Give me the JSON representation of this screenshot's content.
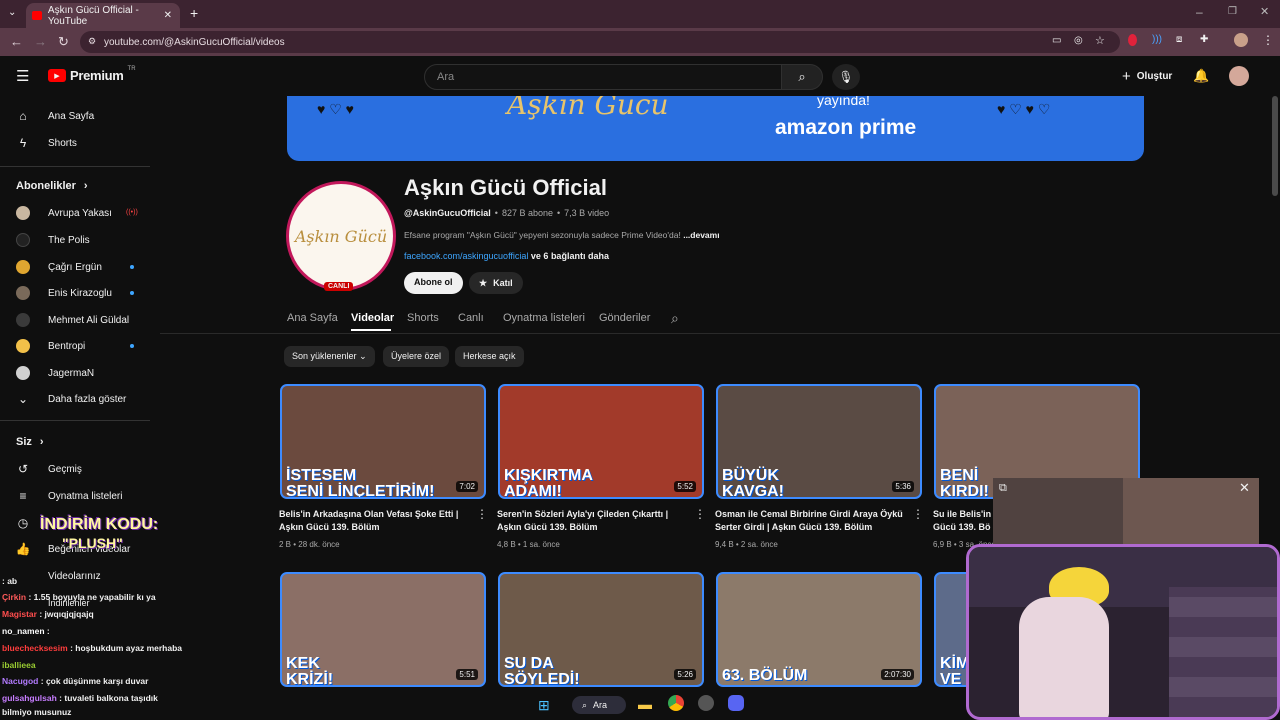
{
  "browser": {
    "tab_title": "Aşkın Gücü Official - YouTube",
    "url": "youtube.com/@AskinGucuOfficial/videos"
  },
  "header": {
    "logo": "Premium",
    "logo_region": "TR",
    "search_placeholder": "Ara",
    "create_label": "Oluştur"
  },
  "sidebar": {
    "main": [
      {
        "label": "Ana Sayfa",
        "icon": "home-icon"
      },
      {
        "label": "Shorts",
        "icon": "shorts-icon"
      }
    ],
    "subs_heading": "Abonelikler",
    "subs": [
      {
        "label": "Avrupa Yakası",
        "color": "#c9b7a0",
        "badge": "live"
      },
      {
        "label": "The Polis",
        "color": "#222222",
        "badge": ""
      },
      {
        "label": "Çağrı Ergün",
        "color": "#e0a630",
        "badge": "dot"
      },
      {
        "label": "Enis Kirazoglu",
        "color": "#7a6a5a",
        "badge": "dot"
      },
      {
        "label": "Mehmet Ali Güldal",
        "color": "#3a3a3a",
        "badge": ""
      },
      {
        "label": "Bentropi",
        "color": "#f2c049",
        "badge": "dot"
      },
      {
        "label": "JagermaN",
        "color": "#d0d0d0",
        "badge": ""
      }
    ],
    "more_label": "Daha fazla göster",
    "you_heading": "Siz",
    "you": [
      {
        "label": "Geçmiş",
        "icon": "history-icon"
      },
      {
        "label": "Oynatma listeleri",
        "icon": "playlist-icon"
      },
      {
        "label": "Videolarınız",
        "icon": "video-icon"
      },
      {
        "label": "Beğenilen videolar",
        "icon": "like-icon"
      },
      {
        "label": "İndirilenler",
        "icon": "download-icon"
      }
    ]
  },
  "channel": {
    "banner_text": "amazon prime",
    "banner_text_top": "Aşkın Gücü",
    "banner_text_side": "yayında!",
    "name": "Aşkın Gücü Official",
    "handle": "@AskinGucuOfficial",
    "subscribers": "827 B abone",
    "videos_count": "7,3 B video",
    "description": "Efsane program \"Aşkın Gücü\" yepyeni sezonuyla sadece Prime Video'da!",
    "more_label": "...devamı",
    "link": "facebook.com/askingucuofficial",
    "link_more": "ve 6 bağlantı daha",
    "subscribe_label": "Abone ol",
    "join_label": "Katıl",
    "live_badge": "CANLI",
    "avatar_text": "Aşkın Gücü"
  },
  "tabs": [
    "Ana Sayfa",
    "Videolar",
    "Shorts",
    "Canlı",
    "Oynatma listeleri",
    "Gönderiler"
  ],
  "active_tab": "Videolar",
  "filters": [
    "Son yüklenenler",
    "Üyelere özel",
    "Herkese açık"
  ],
  "videos": [
    {
      "caption1": "İSTESEM",
      "caption2": "SENİ LİNÇLETİRİM!",
      "duration": "7:02",
      "title": "Belis'in Arkadaşına Olan Vefası Şoke Etti | Aşkın Gücü 139. Bölüm",
      "meta": "2 B • 28 dk. önce",
      "bg": "#6b4a3e"
    },
    {
      "caption1": "KIŞKIRTMA",
      "caption2": "ADAMI!",
      "duration": "5:52",
      "title": "Seren'in Sözleri Ayla'yı Çileden Çıkarttı | Aşkın Gücü 139. Bölüm",
      "meta": "4,8 B • 1 sa. önce",
      "bg": "#a23a2a"
    },
    {
      "caption1": "BÜYÜK",
      "caption2": "KAVGA!",
      "duration": "5:36",
      "title": "Osman ile Cemal Birbirine Girdi Araya Öykü Serter Girdi | Aşkın Gücü 139. Bölüm",
      "meta": "9,4 B • 2 sa. önce",
      "bg": "#5a4b44"
    },
    {
      "caption1": "BENİ",
      "caption2": "KIRDI!",
      "duration": "",
      "title": "Su ile Belis'in A",
      "title2": "Gücü 139. Bö",
      "meta": "6,9 B • 3 sa. önce",
      "bg": "#7b6258"
    },
    {
      "caption1": "KEK",
      "caption2": "KRİZİ!",
      "duration": "5:51",
      "title": "",
      "meta": "",
      "bg": "#8b6f66"
    },
    {
      "caption1": "SU DA",
      "caption2": "SÖYLEDİ!",
      "duration": "5:26",
      "title": "",
      "meta": "",
      "bg": "#6e5a4a"
    },
    {
      "caption1": "",
      "caption2": "63. BÖLÜM",
      "duration": "2:07:30",
      "title": "",
      "meta": "",
      "bg": "#8c7a6a"
    },
    {
      "caption1": "KİM",
      "caption2": "VE",
      "duration": "",
      "title": "",
      "meta": "",
      "bg": "#5d6b8a"
    }
  ],
  "overlay": {
    "promo_line1": "İNDİRİM KODU:",
    "promo_line2": "\"PLUSH\"",
    "chat": [
      {
        "user": "",
        "text": ": ab"
      },
      {
        "user": "Çirkin",
        "text": ": 1.55 boyuyla ne yapabilir kı ya",
        "color": "#ff5a5a"
      },
      {
        "user": "Magistar",
        "text": ": jwqıqjqjqajq",
        "color": "#ff4d4d"
      },
      {
        "user": "no_namen",
        "text": ":",
        "color": "#ffffff"
      },
      {
        "user": "bluechecksesim",
        "text": ": hoşbukdum ayaz merhaba",
        "color": "#ff3d3d"
      },
      {
        "user": "iballieea",
        "text": "",
        "color": "#9acd32"
      },
      {
        "user": "Nacugod",
        "text": ": çok düşünme karşı duvar",
        "color": "#b37bff"
      },
      {
        "user": "gulsahgulsah",
        "text": ": tuvaleti balkona taşıdık",
        "color": "#c77dff"
      },
      {
        "user": "",
        "text": "bilmiyo musunuz"
      }
    ]
  },
  "taskbar": {
    "search_label": "Ara"
  }
}
